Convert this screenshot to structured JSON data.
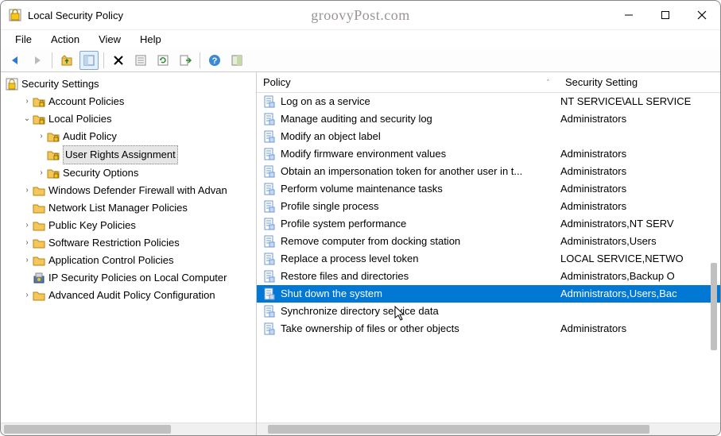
{
  "window": {
    "title": "Local Security Policy",
    "watermark": "groovyPost.com"
  },
  "menu": [
    "File",
    "Action",
    "View",
    "Help"
  ],
  "tree": {
    "root": "Security Settings",
    "nodes": [
      {
        "label": "Account Policies",
        "indent": 1,
        "arrow": "right",
        "icon": "folder-lock"
      },
      {
        "label": "Local Policies",
        "indent": 1,
        "arrow": "down",
        "icon": "folder-lock"
      },
      {
        "label": "Audit Policy",
        "indent": 2,
        "arrow": "right",
        "icon": "folder-lock"
      },
      {
        "label": "User Rights Assignment",
        "indent": 2,
        "arrow": "none",
        "icon": "folder-lock",
        "selected": true
      },
      {
        "label": "Security Options",
        "indent": 2,
        "arrow": "right",
        "icon": "folder-lock"
      },
      {
        "label": "Windows Defender Firewall with Advan",
        "indent": 1,
        "arrow": "right",
        "icon": "folder"
      },
      {
        "label": "Network List Manager Policies",
        "indent": 1,
        "arrow": "none",
        "icon": "folder"
      },
      {
        "label": "Public Key Policies",
        "indent": 1,
        "arrow": "right",
        "icon": "folder"
      },
      {
        "label": "Software Restriction Policies",
        "indent": 1,
        "arrow": "right",
        "icon": "folder"
      },
      {
        "label": "Application Control Policies",
        "indent": 1,
        "arrow": "right",
        "icon": "folder"
      },
      {
        "label": "IP Security Policies on Local Computer",
        "indent": 1,
        "arrow": "none",
        "icon": "ipsec"
      },
      {
        "label": "Advanced Audit Policy Configuration",
        "indent": 1,
        "arrow": "right",
        "icon": "folder"
      }
    ]
  },
  "list": {
    "headers": {
      "col1": "Policy",
      "col2": "Security Setting"
    },
    "rows": [
      {
        "policy": "Log on as a service",
        "setting": "NT SERVICE\\ALL SERVICE"
      },
      {
        "policy": "Manage auditing and security log",
        "setting": "Administrators"
      },
      {
        "policy": "Modify an object label",
        "setting": ""
      },
      {
        "policy": "Modify firmware environment values",
        "setting": "Administrators"
      },
      {
        "policy": "Obtain an impersonation token for another user in t...",
        "setting": "Administrators"
      },
      {
        "policy": "Perform volume maintenance tasks",
        "setting": "Administrators"
      },
      {
        "policy": "Profile single process",
        "setting": "Administrators"
      },
      {
        "policy": "Profile system performance",
        "setting": "Administrators,NT SERV"
      },
      {
        "policy": "Remove computer from docking station",
        "setting": "Administrators,Users"
      },
      {
        "policy": "Replace a process level token",
        "setting": "LOCAL SERVICE,NETWO"
      },
      {
        "policy": "Restore files and directories",
        "setting": "Administrators,Backup O"
      },
      {
        "policy": "Shut down the system",
        "setting": "Administrators,Users,Bac",
        "selected": true
      },
      {
        "policy": "Synchronize directory service data",
        "setting": ""
      },
      {
        "policy": "Take ownership of files or other objects",
        "setting": "Administrators"
      }
    ]
  }
}
